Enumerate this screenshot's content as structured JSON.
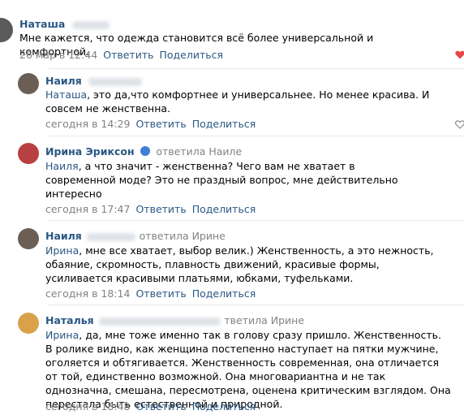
{
  "comments": [
    {
      "author": "Наташа",
      "reply_label": "",
      "text_mention": "",
      "text": "Мне кажется, что одежда становится всё более универсальной и комфортной.",
      "date": "26 мар в 12:44",
      "reply_btn": "Ответить",
      "share_btn": "Поделиться",
      "liked": true
    },
    {
      "author": "Наиля",
      "reply_label": "",
      "text_mention": "Наташа",
      "text": ", это да,что комфортнее и универсальнее. Но менее красива. И совсем не женственна.",
      "date": "сегодня в 14:29",
      "reply_btn": "Ответить",
      "share_btn": "Поделиться",
      "liked": false
    },
    {
      "author": "Ирина Эриксон",
      "reply_label": "ответила Наиле",
      "text_mention": "Наиля",
      "text": ", а что значит - женственна? Чего вам не хватает в современной моде? Это не праздный вопрос, мне действительно интересно",
      "date": "сегодня в 17:47",
      "reply_btn": "Ответить",
      "share_btn": "Поделиться"
    },
    {
      "author": "Наиля",
      "reply_label": "ответила Ирине",
      "text_mention": "Ирина",
      "text": ", мне все хватает, выбор велик.) Женственность, а это нежность, обаяние, скромность, плавность движений, красивые формы, усиливается красивыми платьями, юбками, туфельками.",
      "date": "сегодня в 18:14",
      "reply_btn": "Ответить",
      "share_btn": "Поделиться"
    },
    {
      "author": "Наталья",
      "reply_label": "тветила Ирине",
      "text_mention": "Ирина",
      "text": ", да, мне тоже именно так в голову сразу пришло. Женственность. В ролике видно, как женщина постепенно наступает на пятки мужчине, оголяется и обтягивается. Женственность современная, она отличается от той, единственно возможной. Она многовариантна и не так однозначна, смешана, пересмотрена, оценена критическим взглядом. Она перестала быть естественной и природной.",
      "date": "сегодня в 18:48",
      "reply_btn": "Ответить",
      "share_btn": "Поделиться"
    }
  ],
  "colors": {
    "link": "#2a5885",
    "meta": "#828282",
    "heart_active": "#e64646",
    "separator": "#e7e8ec"
  },
  "icons": [
    "heart-icon",
    "heart-outline-icon",
    "vk-badge-icon"
  ]
}
